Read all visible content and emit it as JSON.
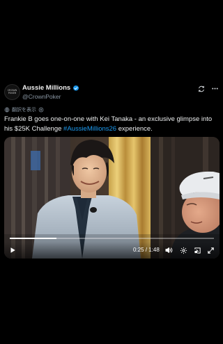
{
  "account": {
    "avatar_text": "CROWN POKER",
    "display_name": "Aussie Millions",
    "handle": "@CrownPoker",
    "verified": true
  },
  "translate": {
    "label": "翻訳を表示"
  },
  "tweet": {
    "text_before": "Frankie B goes one-on-one with Kei Tanaka - an exclusive glimpse into his $25K Challenge ",
    "hashtag": "#AussieMillions26",
    "text_after": " experience."
  },
  "video": {
    "current_time": "0:25",
    "duration": "1:48",
    "time_display": "0:25 / 1:48",
    "progress_fraction": 0.23
  },
  "icons": {
    "refresh": "refresh-icon",
    "more": "more-icon",
    "translate": "globe-icon",
    "play": "play-icon",
    "volume": "volume-icon",
    "settings": "gear-icon",
    "pip": "picture-in-picture-icon",
    "fullscreen": "fullscreen-icon"
  },
  "colors": {
    "background": "#000000",
    "text": "#e7e9ea",
    "secondary": "#8b98a5",
    "accent": "#1d9bf0"
  }
}
